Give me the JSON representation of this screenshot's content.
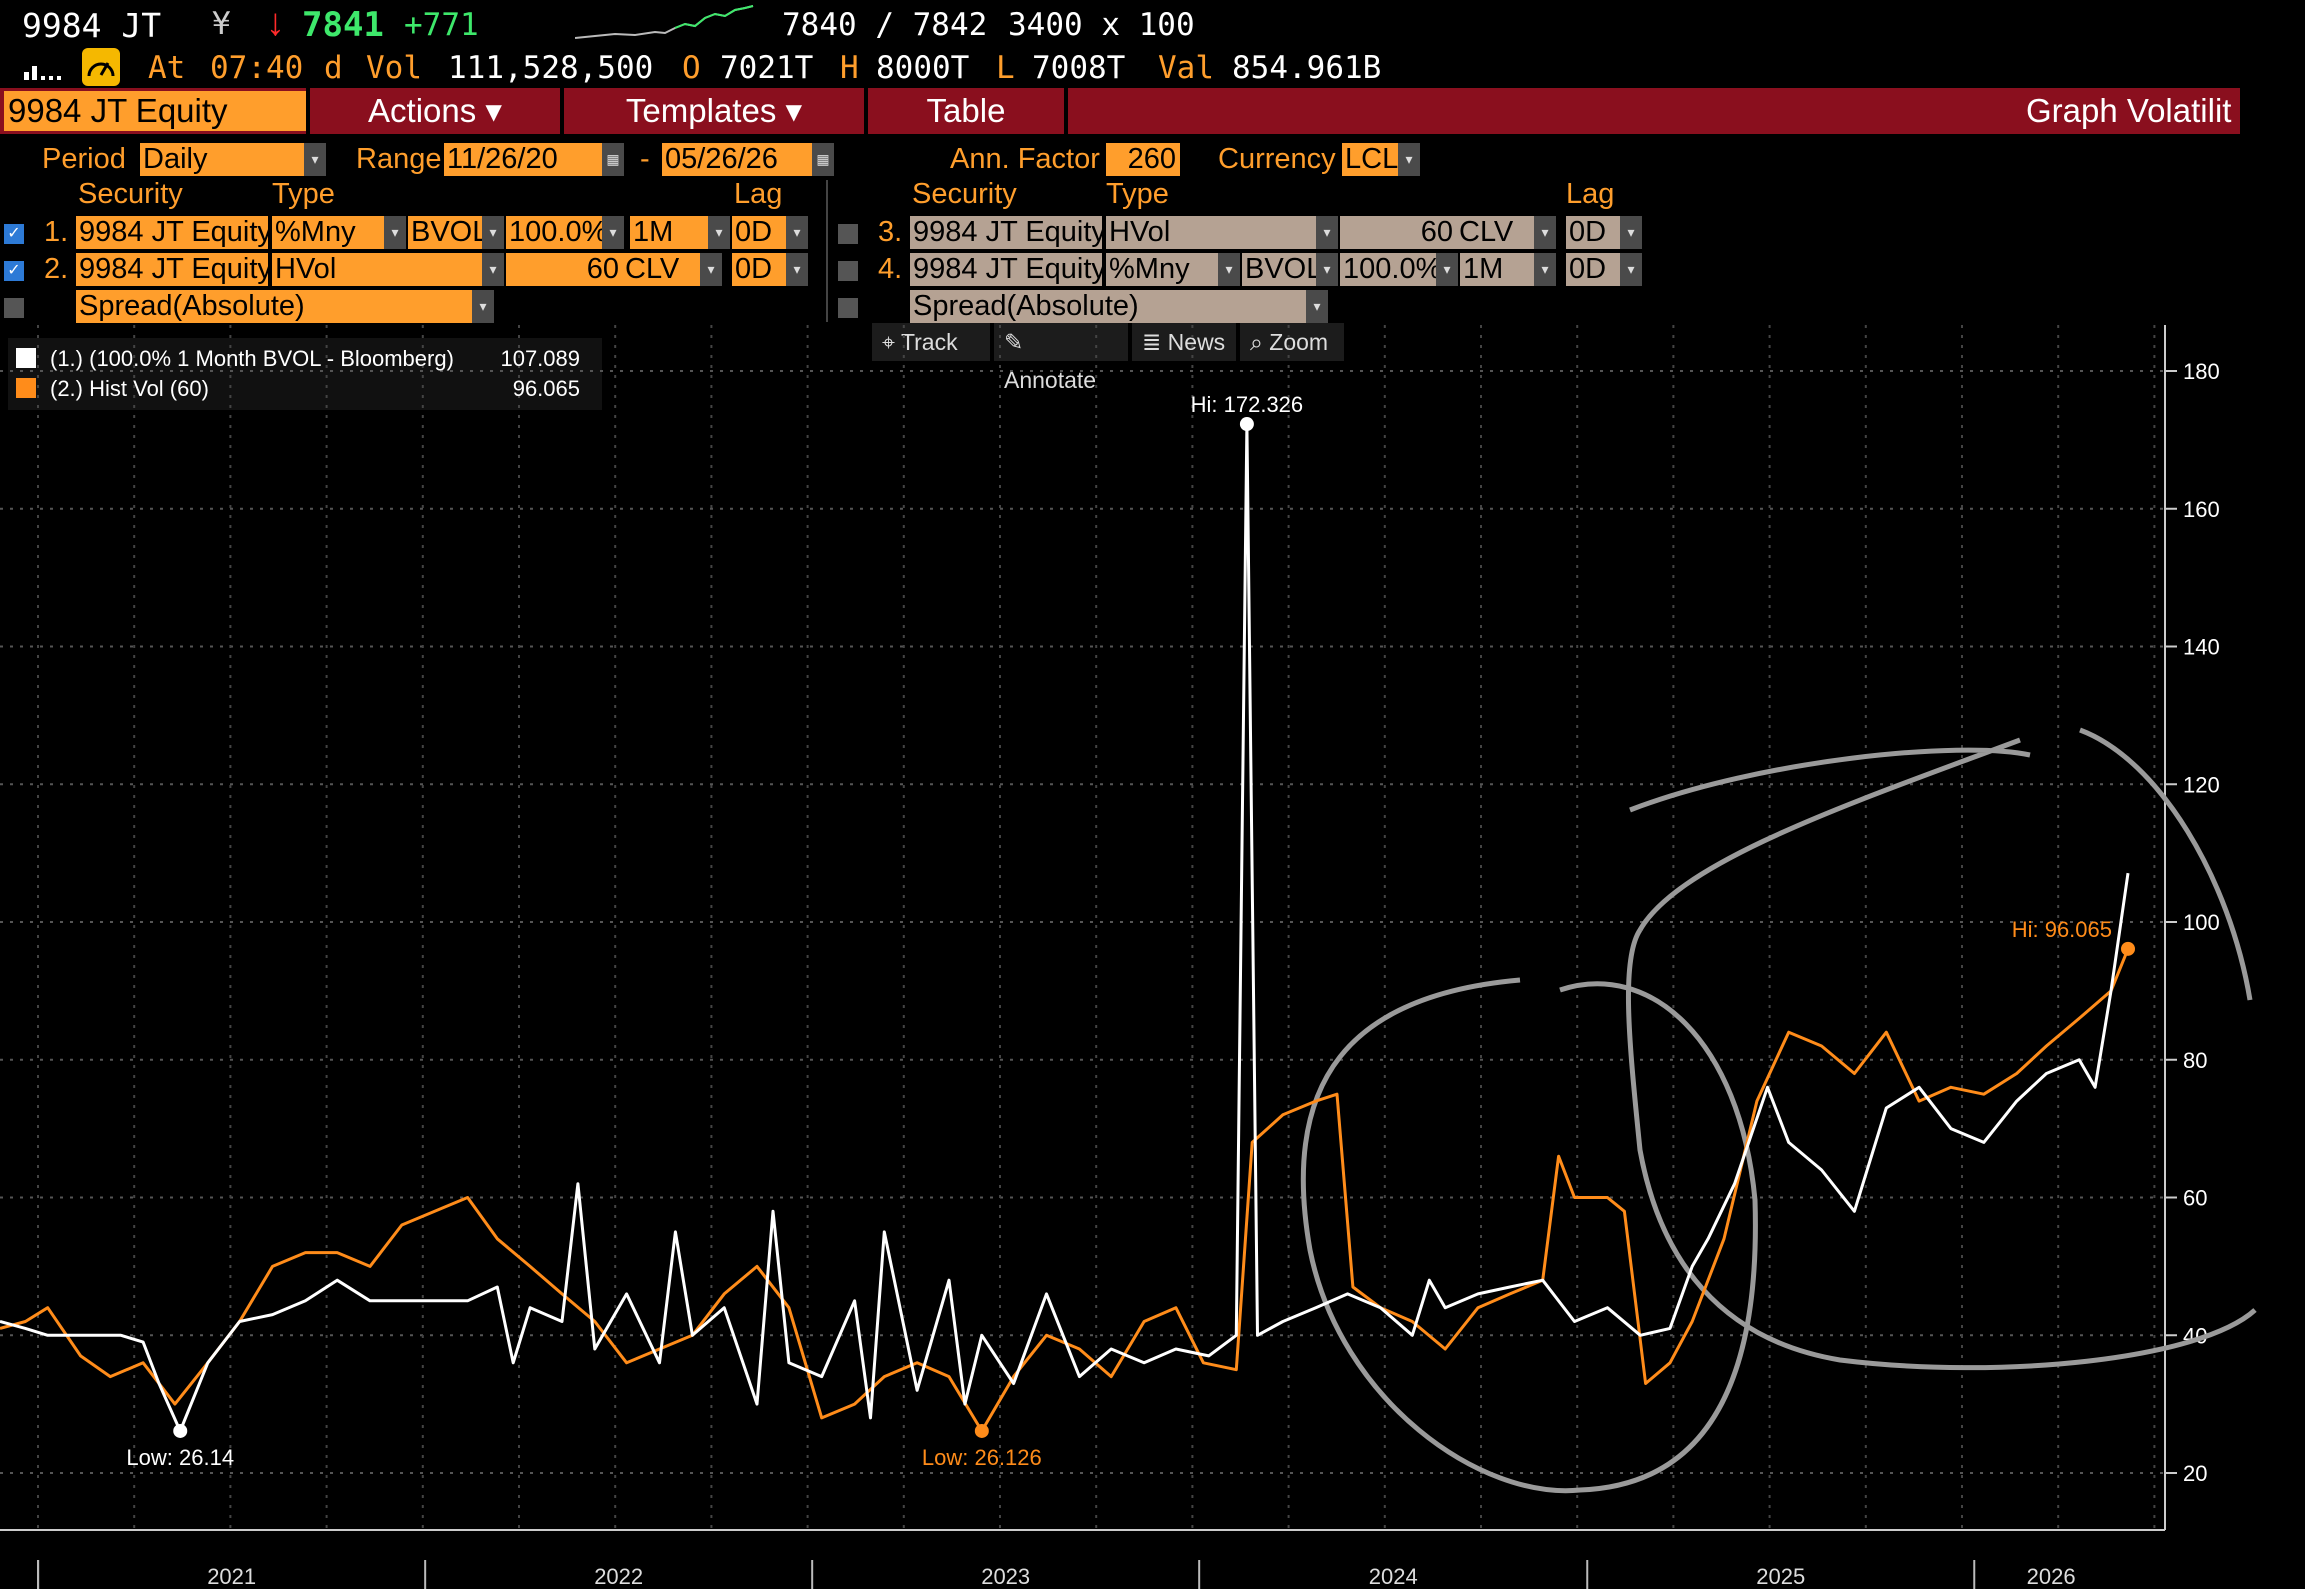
{
  "header": {
    "ticker": "9984 JT",
    "currency_sym": "¥",
    "arrow": "↓",
    "last": "7841",
    "change": "+771",
    "bid_ask": "7840 / 7842",
    "size": "3400 x 100",
    "at_label": "At",
    "time": "07:40",
    "d_flag": "d",
    "vol_label": "Vol",
    "vol": "111,528,500",
    "open_label": "O",
    "open": "7021T",
    "high_label": "H",
    "high": "8000T",
    "low_label": "L",
    "low": "7008T",
    "val_label": "Val",
    "val": "854.961B"
  },
  "menu": {
    "security": "9984 JT Equity",
    "actions": "Actions ▾",
    "templates": "Templates ▾",
    "table": "Table",
    "title": "Graph Volatilit"
  },
  "settings": {
    "period_label": "Period",
    "period": "Daily",
    "range_label": "Range",
    "range_start": "11/26/20",
    "range_dash": "-",
    "range_end": "05/26/26",
    "ann_label": "Ann. Factor",
    "ann": "260",
    "currency_label": "Currency",
    "currency": "LCL"
  },
  "col_headers": {
    "security": "Security",
    "type": "Type",
    "lag": "Lag"
  },
  "rows_left": [
    {
      "num": "1.",
      "security": "9984 JT Equity",
      "type": "%Mny",
      "sub": "BVOL",
      "pct": "100.0%",
      "tenor": "1M",
      "lag": "0D"
    },
    {
      "num": "2.",
      "security": "9984 JT Equity",
      "type": "HVol",
      "window": "60",
      "src": "CLV",
      "lag": "0D"
    },
    {
      "spread": "Spread(Absolute)"
    }
  ],
  "rows_right": [
    {
      "num": "3.",
      "security": "9984 JT Equity",
      "type": "HVol",
      "window": "60",
      "src": "CLV",
      "lag": "0D"
    },
    {
      "num": "4.",
      "security": "9984 JT Equity",
      "type": "%Mny",
      "sub": "BVOL",
      "pct": "100.0%",
      "tenor": "1M",
      "lag": "0D"
    },
    {
      "spread": "Spread(Absolute)"
    }
  ],
  "toolbar": {
    "track": "Track",
    "annotate": "Annotate",
    "news": "News",
    "zoom": "Zoom"
  },
  "colors": {
    "series1": "#ffffff",
    "series2": "#ff8c1a",
    "annotation_circles": "#9a9a9a",
    "menu_bar": "#8a0f1e",
    "field": "#ff9e2c"
  },
  "chart_data": {
    "type": "line",
    "x_ticks": [
      "2021",
      "2022",
      "2023",
      "2024",
      "2025",
      "2026"
    ],
    "y_ticks": [
      20,
      40,
      60,
      80,
      100,
      120,
      140,
      160,
      180
    ],
    "ylim": [
      10,
      185
    ],
    "y_axis_side": "right",
    "grid": true,
    "legend_position": "top-left",
    "legend": [
      {
        "label": "(1.)  (100.0% 1 Month BVOL - Bloomberg)",
        "last": "107.089",
        "color": "#ffffff"
      },
      {
        "label": "(2.) Hist Vol (60)",
        "last": "96.065",
        "color": "#ff8c1a"
      }
    ],
    "annotations": [
      {
        "text": "Hi: 172.326",
        "date": "2024-02-15",
        "value": 172.3,
        "series": 1
      },
      {
        "text": "Low: 26.14",
        "date": "2021-05-15",
        "value": 26.1,
        "series": 1
      },
      {
        "text": "Low: 26.126",
        "date": "2023-06-10",
        "value": 26.1,
        "series": 2
      },
      {
        "text": "Hi: 96.065",
        "date": "2026-05-26",
        "value": 96.1,
        "series": 2
      }
    ],
    "series": [
      {
        "name": "(100.0% 1 Month BVOL - Bloomberg)",
        "points": [
          [
            "2020-11-26",
            42
          ],
          [
            "2020-12-20",
            41
          ],
          [
            "2021-01-10",
            40
          ],
          [
            "2021-02-15",
            40
          ],
          [
            "2021-03-20",
            40
          ],
          [
            "2021-04-10",
            39
          ],
          [
            "2021-04-25",
            33
          ],
          [
            "2021-05-15",
            26.1
          ],
          [
            "2021-06-10",
            36
          ],
          [
            "2021-07-10",
            42
          ],
          [
            "2021-08-10",
            43
          ],
          [
            "2021-09-10",
            45
          ],
          [
            "2021-10-10",
            48
          ],
          [
            "2021-11-10",
            45
          ],
          [
            "2021-12-10",
            45
          ],
          [
            "2022-01-10",
            45
          ],
          [
            "2022-02-10",
            45
          ],
          [
            "2022-03-10",
            47
          ],
          [
            "2022-03-25",
            36
          ],
          [
            "2022-04-10",
            44
          ],
          [
            "2022-05-10",
            42
          ],
          [
            "2022-05-25",
            62
          ],
          [
            "2022-06-10",
            38
          ],
          [
            "2022-07-10",
            46
          ],
          [
            "2022-08-10",
            36
          ],
          [
            "2022-08-25",
            55
          ],
          [
            "2022-09-10",
            40
          ],
          [
            "2022-10-10",
            44
          ],
          [
            "2022-11-10",
            30
          ],
          [
            "2022-11-25",
            58
          ],
          [
            "2022-12-10",
            36
          ],
          [
            "2023-01-10",
            34
          ],
          [
            "2023-02-10",
            45
          ],
          [
            "2023-02-25",
            28
          ],
          [
            "2023-03-10",
            55
          ],
          [
            "2023-04-10",
            32
          ],
          [
            "2023-05-10",
            48
          ],
          [
            "2023-05-25",
            30
          ],
          [
            "2023-06-10",
            40
          ],
          [
            "2023-07-10",
            33
          ],
          [
            "2023-08-10",
            46
          ],
          [
            "2023-09-10",
            34
          ],
          [
            "2023-10-10",
            38
          ],
          [
            "2023-11-10",
            36
          ],
          [
            "2023-12-10",
            38
          ],
          [
            "2024-01-10",
            37
          ],
          [
            "2024-02-05",
            40
          ],
          [
            "2024-02-15",
            172.3
          ],
          [
            "2024-02-25",
            40
          ],
          [
            "2024-03-20",
            42
          ],
          [
            "2024-04-20",
            44
          ],
          [
            "2024-05-20",
            46
          ],
          [
            "2024-06-20",
            44
          ],
          [
            "2024-07-20",
            40
          ],
          [
            "2024-08-05",
            48
          ],
          [
            "2024-08-20",
            44
          ],
          [
            "2024-09-20",
            46
          ],
          [
            "2024-10-20",
            47
          ],
          [
            "2024-11-20",
            48
          ],
          [
            "2024-12-20",
            42
          ],
          [
            "2025-01-20",
            44
          ],
          [
            "2025-02-20",
            40
          ],
          [
            "2025-03-20",
            41
          ],
          [
            "2025-04-10",
            50
          ],
          [
            "2025-04-25",
            54
          ],
          [
            "2025-05-20",
            62
          ],
          [
            "2025-06-20",
            76
          ],
          [
            "2025-07-10",
            68
          ],
          [
            "2025-08-10",
            64
          ],
          [
            "2025-09-10",
            58
          ],
          [
            "2025-10-10",
            73
          ],
          [
            "2025-11-10",
            76
          ],
          [
            "2025-12-10",
            70
          ],
          [
            "2026-01-10",
            68
          ],
          [
            "2026-02-10",
            74
          ],
          [
            "2026-03-10",
            78
          ],
          [
            "2026-04-10",
            80
          ],
          [
            "2026-04-25",
            76
          ],
          [
            "2026-05-10",
            90
          ],
          [
            "2026-05-26",
            107.1
          ]
        ]
      },
      {
        "name": "Hist Vol (60)",
        "points": [
          [
            "2020-11-26",
            41
          ],
          [
            "2020-12-20",
            42
          ],
          [
            "2021-01-10",
            44
          ],
          [
            "2021-02-10",
            37
          ],
          [
            "2021-03-10",
            34
          ],
          [
            "2021-04-10",
            36
          ],
          [
            "2021-05-10",
            30
          ],
          [
            "2021-06-10",
            36
          ],
          [
            "2021-07-10",
            42
          ],
          [
            "2021-08-10",
            50
          ],
          [
            "2021-09-10",
            52
          ],
          [
            "2021-10-10",
            52
          ],
          [
            "2021-11-10",
            50
          ],
          [
            "2021-12-10",
            56
          ],
          [
            "2022-01-10",
            58
          ],
          [
            "2022-02-10",
            60
          ],
          [
            "2022-03-10",
            54
          ],
          [
            "2022-04-10",
            50
          ],
          [
            "2022-05-10",
            46
          ],
          [
            "2022-06-10",
            42
          ],
          [
            "2022-07-10",
            36
          ],
          [
            "2022-08-10",
            38
          ],
          [
            "2022-09-10",
            40
          ],
          [
            "2022-10-10",
            46
          ],
          [
            "2022-11-10",
            50
          ],
          [
            "2022-12-10",
            44
          ],
          [
            "2023-01-10",
            28
          ],
          [
            "2023-02-10",
            30
          ],
          [
            "2023-03-10",
            34
          ],
          [
            "2023-04-10",
            36
          ],
          [
            "2023-05-10",
            34
          ],
          [
            "2023-06-10",
            26.1
          ],
          [
            "2023-07-10",
            34
          ],
          [
            "2023-08-10",
            40
          ],
          [
            "2023-09-10",
            38
          ],
          [
            "2023-10-10",
            34
          ],
          [
            "2023-11-10",
            42
          ],
          [
            "2023-12-10",
            44
          ],
          [
            "2024-01-05",
            36
          ],
          [
            "2024-02-05",
            35
          ],
          [
            "2024-02-20",
            68
          ],
          [
            "2024-03-20",
            72
          ],
          [
            "2024-04-20",
            74
          ],
          [
            "2024-05-10",
            75
          ],
          [
            "2024-05-25",
            47
          ],
          [
            "2024-06-20",
            44
          ],
          [
            "2024-07-20",
            42
          ],
          [
            "2024-08-20",
            38
          ],
          [
            "2024-09-20",
            44
          ],
          [
            "2024-10-20",
            46
          ],
          [
            "2024-11-20",
            48
          ],
          [
            "2024-12-05",
            66
          ],
          [
            "2024-12-20",
            60
          ],
          [
            "2025-01-20",
            60
          ],
          [
            "2025-02-05",
            58
          ],
          [
            "2025-02-25",
            33
          ],
          [
            "2025-03-20",
            36
          ],
          [
            "2025-04-10",
            42
          ],
          [
            "2025-05-10",
            54
          ],
          [
            "2025-06-10",
            74
          ],
          [
            "2025-07-10",
            84
          ],
          [
            "2025-08-10",
            82
          ],
          [
            "2025-09-10",
            78
          ],
          [
            "2025-10-10",
            84
          ],
          [
            "2025-11-10",
            74
          ],
          [
            "2025-12-10",
            76
          ],
          [
            "2026-01-10",
            75
          ],
          [
            "2026-02-10",
            78
          ],
          [
            "2026-03-10",
            82
          ],
          [
            "2026-04-10",
            86
          ],
          [
            "2026-05-10",
            90
          ],
          [
            "2026-05-26",
            96.1
          ]
        ]
      }
    ]
  }
}
